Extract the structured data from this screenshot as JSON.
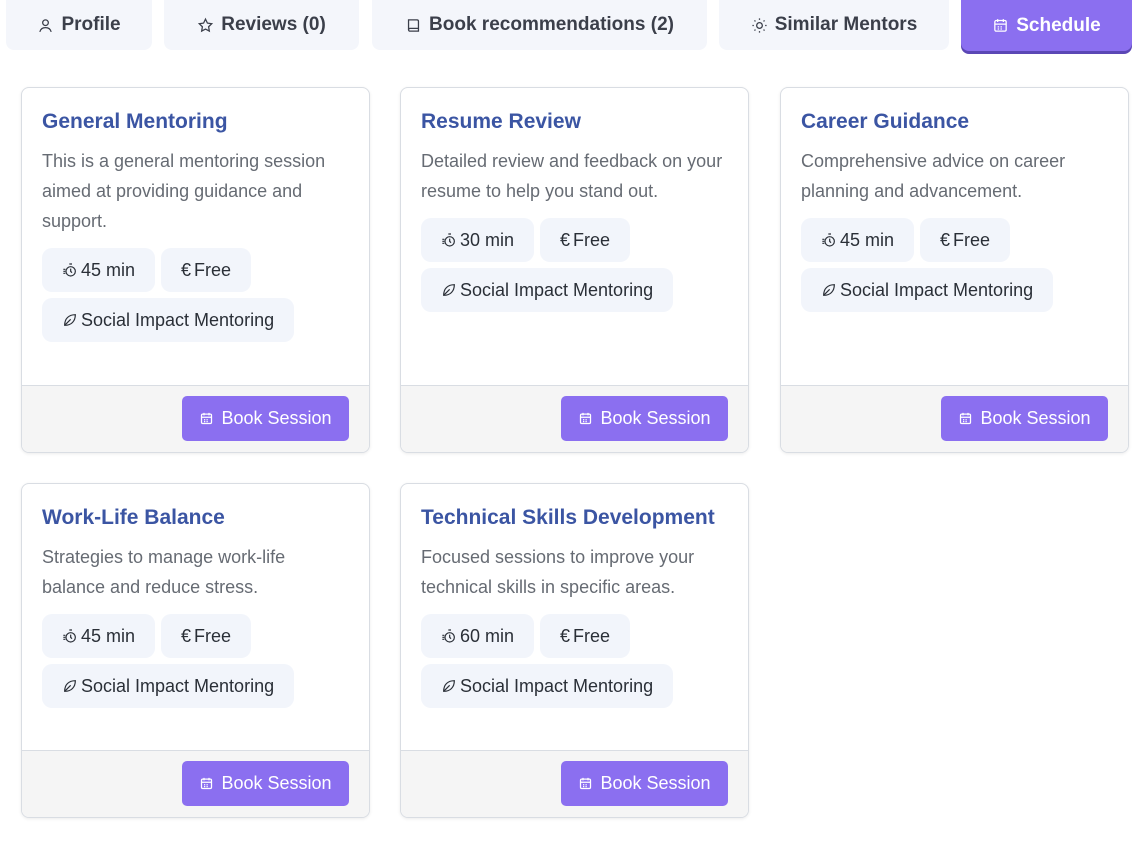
{
  "tabs": [
    {
      "label": "Profile",
      "icon": "user-icon",
      "active": false
    },
    {
      "label": "Reviews (0)",
      "icon": "star-icon",
      "active": false
    },
    {
      "label": "Book recommendations (2)",
      "icon": "book-icon",
      "active": false
    },
    {
      "label": "Similar Mentors",
      "icon": "sun-icon",
      "active": false
    },
    {
      "label": "Schedule",
      "icon": "calendar-icon",
      "active": true
    }
  ],
  "accent_color": "#8b6ff0",
  "title_color": "#3b55a3",
  "sessions": [
    {
      "title": "General Mentoring",
      "description": "This is a general mentoring session aimed at providing guidance and support.",
      "duration": "45 min",
      "price": "Free",
      "category": "Social Impact Mentoring",
      "button": "Book Session"
    },
    {
      "title": "Resume Review",
      "description": "Detailed review and feedback on your resume to help you stand out.",
      "duration": "30 min",
      "price": "Free",
      "category": "Social Impact Mentoring",
      "button": "Book Session"
    },
    {
      "title": "Career Guidance",
      "description": "Comprehensive advice on career planning and advancement.",
      "duration": "45 min",
      "price": "Free",
      "category": "Social Impact Mentoring",
      "button": "Book Session"
    },
    {
      "title": "Work-Life Balance",
      "description": "Strategies to manage work-life balance and reduce stress.",
      "duration": "45 min",
      "price": "Free",
      "category": "Social Impact Mentoring",
      "button": "Book Session"
    },
    {
      "title": "Technical Skills Development",
      "description": "Focused sessions to improve your technical skills in specific areas.",
      "duration": "60 min",
      "price": "Free",
      "category": "Social Impact Mentoring",
      "button": "Book Session"
    }
  ]
}
